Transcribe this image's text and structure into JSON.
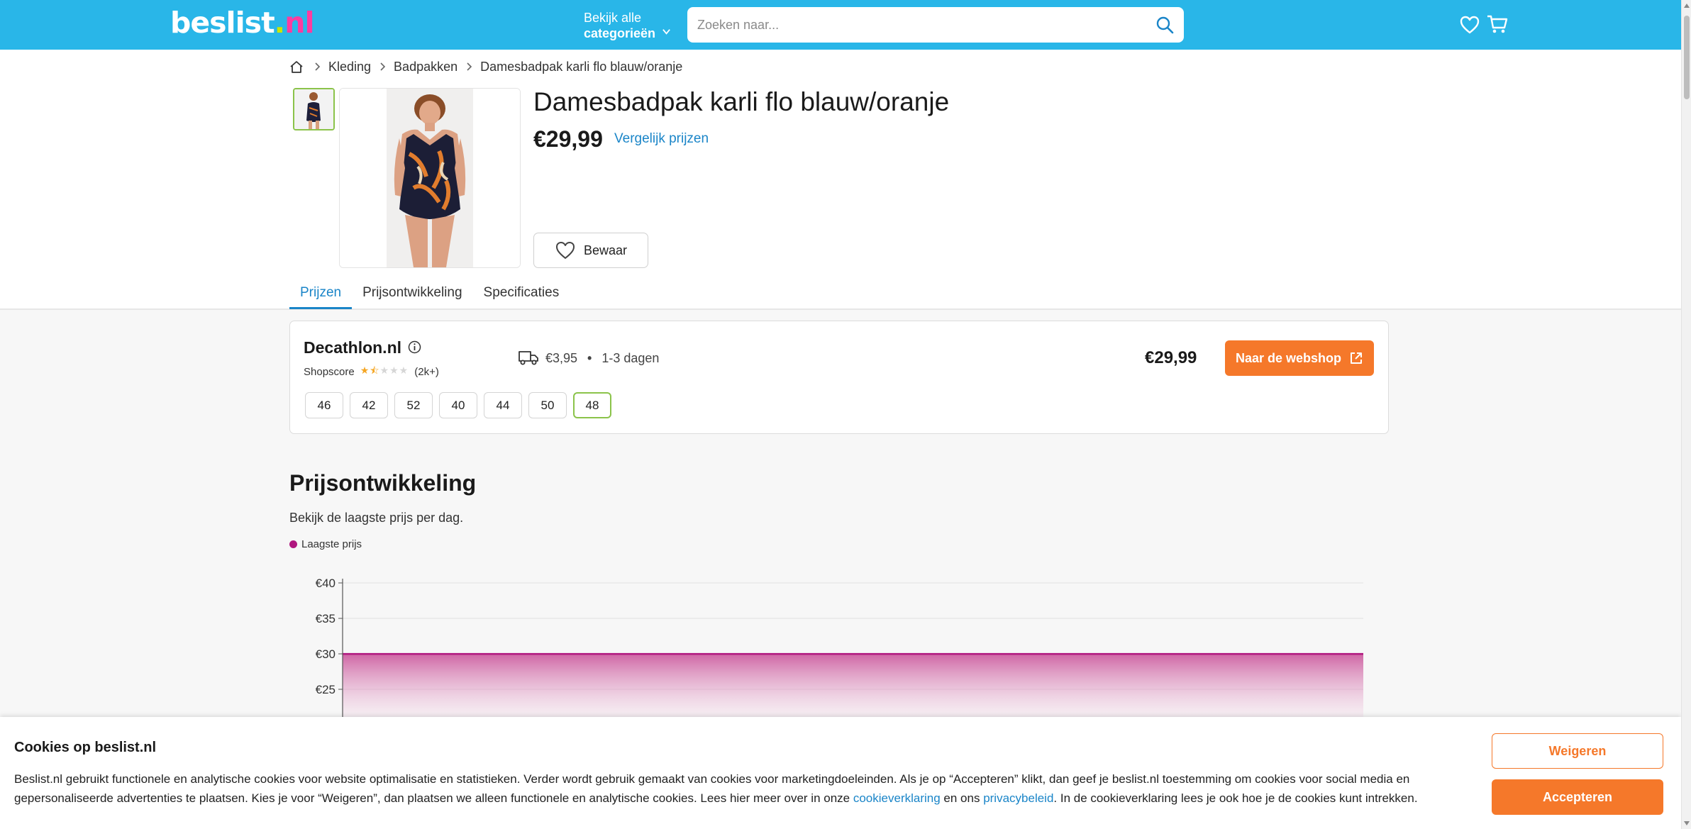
{
  "header": {
    "logo_main": "beslist",
    "logo_dot": ".",
    "logo_tld": "nl",
    "categories_line1": "Bekijk alle",
    "categories_line2": "categorieën",
    "search_placeholder": "Zoeken naar...",
    "bg_color": "#29b6e8"
  },
  "breadcrumb": {
    "items": [
      "Kleding",
      "Badpakken",
      "Damesbadpak karli flo blauw/oranje"
    ]
  },
  "product": {
    "title": "Damesbadpak karli flo blauw/oranje",
    "price": "€29,99",
    "compare_link": "Vergelijk prijzen",
    "save_label": "Bewaar"
  },
  "tabs": [
    {
      "label": "Prijzen",
      "active": true
    },
    {
      "label": "Prijsontwikkeling",
      "active": false
    },
    {
      "label": "Specificaties",
      "active": false
    }
  ],
  "offer": {
    "shop": "Decathlon.nl",
    "shopscore_label": "Shopscore",
    "rating": 1.5,
    "rating_max": 5,
    "review_count": "(2k+)",
    "shipping_cost": "€3,95",
    "delivery": "1-3 dagen",
    "price": "€29,99",
    "cta": "Naar de webshop",
    "sizes": [
      "46",
      "42",
      "52",
      "40",
      "44",
      "50",
      "48"
    ],
    "selected_size": "48",
    "accent_color": "#f5782a"
  },
  "price_development": {
    "title": "Prijsontwikkeling",
    "subtitle": "Bekijk de laagste prijs per dag.",
    "legend": "Laagste prijs"
  },
  "chart_data": {
    "type": "area",
    "series": [
      {
        "name": "Laagste prijs",
        "values": [
          29.99,
          29.99
        ]
      }
    ],
    "y_ticks": [
      "€40",
      "€35",
      "€30",
      "€25"
    ],
    "ylim": [
      20,
      40
    ],
    "grid": true,
    "color": "#b0177f"
  },
  "cookie": {
    "title": "Cookies op beslist.nl",
    "text_1": "Beslist.nl gebruikt functionele en analytische cookies voor website optimalisatie en statistieken. Verder wordt gebruik gemaakt van cookies voor marketingdoeleinden. Als je op “Accepteren” klikt, dan geef je beslist.nl toestemming om cookies voor social media en gepersonaliseerde advertenties te plaatsen. Kies je voor “Weigeren”, dan plaatsen we alleen functionele en analytische cookies. Lees hier meer over in onze ",
    "link_1": "cookieverklaring",
    "text_2": " en ons ",
    "link_2": "privacybeleid",
    "text_3": ". In de cookieverklaring lees je ook hoe je de cookies kunt intrekken.",
    "decline": "Weigeren",
    "accept": "Accepteren"
  }
}
